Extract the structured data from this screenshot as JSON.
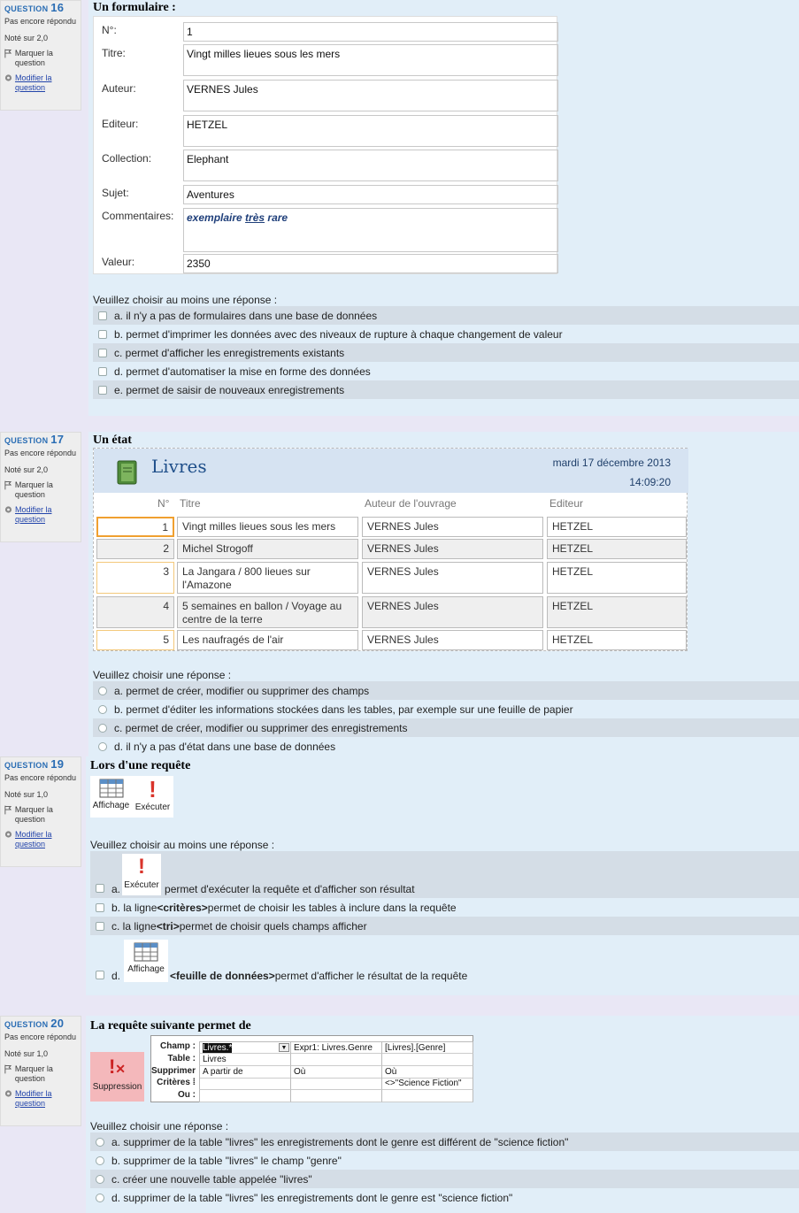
{
  "colors": {
    "accent": "#2a6db4",
    "content_bg": "#e1eef8",
    "alt_row": "#d4dde6",
    "report_header": "#d6e3f2",
    "danger_icon": "#d9342b",
    "suppression_bg": "#f4b8bb"
  },
  "sidebar_common": {
    "status": "Pas encore répondu",
    "flag": "Marquer la question",
    "edit": "Modifier la question",
    "question_word": "QUESTION"
  },
  "q16": {
    "number": "16",
    "grade": "Noté sur 2,0",
    "title": "Un formulaire  :",
    "form": [
      {
        "label": "N°:",
        "value": "1"
      },
      {
        "label": "Titre:",
        "value": "Vingt milles lieues sous les mers"
      },
      {
        "label": "Auteur:",
        "value": "VERNES Jules"
      },
      {
        "label": "Editeur:",
        "value": "HETZEL"
      },
      {
        "label": "Collection:",
        "value": "Elephant"
      },
      {
        "label": "Sujet:",
        "value": "Aventures"
      },
      {
        "label": "Commentaires:",
        "value_a": "exemplaire ",
        "value_b": "très",
        "value_c": " rare"
      },
      {
        "label": "Valeur:",
        "value": "2350"
      }
    ],
    "prompt": "Veuillez choisir au moins une réponse :",
    "options": [
      "a. il n'y a pas de formulaires dans une base de données",
      "b. permet d'imprimer les données avec des niveaux de rupture à chaque changement de valeur",
      "c. permet d'afficher les enregistrements existants",
      "d. permet d'automatiser la mise en forme des données",
      "e. permet de saisir de nouveaux enregistrements"
    ]
  },
  "q17": {
    "number": "17",
    "grade": "Noté sur 2,0",
    "title": "Un état",
    "report": {
      "title": "Livres",
      "date": "mardi 17 décembre 2013",
      "time": "14:09:20",
      "headers": [
        "N°",
        "Titre",
        "Auteur de l'ouvrage",
        "Editeur"
      ],
      "rows": [
        [
          "1",
          "Vingt milles lieues sous les mers",
          "VERNES Jules",
          "HETZEL"
        ],
        [
          "2",
          "Michel Strogoff",
          "VERNES Jules",
          "HETZEL"
        ],
        [
          "3",
          "La Jangara / 800 lieues sur l'Amazone",
          "VERNES Jules",
          "HETZEL"
        ],
        [
          "4",
          "5 semaines en ballon / Voyage au centre de la terre",
          "VERNES Jules",
          "HETZEL"
        ],
        [
          "5",
          "Les naufragés de l'air",
          "VERNES Jules",
          "HETZEL"
        ]
      ]
    },
    "prompt": "Veuillez choisir une réponse :",
    "options": [
      "a. permet de créer, modifier ou supprimer des champs",
      "b. permet d'éditer les informations stockées dans les tables, par exemple sur une feuille de papier",
      "c. permet de créer, modifier ou supprimer des enregistrements",
      "d. il n'y a pas d'état dans une base de données"
    ]
  },
  "q19": {
    "number": "19",
    "grade": "Noté sur 1,0",
    "title": "Lors d'une requête",
    "ribbon": {
      "view": "Affichage",
      "run": "Exécuter"
    },
    "prompt": "Veuillez choisir au moins une réponse :",
    "opt_a_letter": "a.",
    "opt_a_text": " permet d'exécuter la requête et d'afficher son résultat",
    "opt_b_pre": "b. la ligne ",
    "opt_b_bold": "<critères>",
    "opt_b_post": " permet de choisir les tables à inclure dans la requête",
    "opt_c_pre": "c. la ligne ",
    "opt_c_bold": "<tri>",
    "opt_c_post": " permet de choisir quels champs afficher",
    "opt_d_letter": "d.",
    "opt_d_bold": "<feuille de données>",
    "opt_d_post": "permet d'afficher le résultat de la requête"
  },
  "q20": {
    "number": "20",
    "grade": "Noté sur 1,0",
    "title": "La requête suivante permet de",
    "button": "Suppression",
    "grid": {
      "labels": [
        "Champ :",
        "Table :",
        "Supprimer :",
        "Critères :",
        "Ou :"
      ],
      "col1": [
        "Livres.*",
        "Livres",
        "A partir de",
        "",
        ""
      ],
      "col2": [
        "Expr1: Livres.Genre",
        "",
        "Où",
        "",
        ""
      ],
      "col3": [
        "[Livres].[Genre]",
        "",
        "Où",
        "<>\"Science Fiction\"",
        ""
      ]
    },
    "prompt": "Veuillez choisir une réponse :",
    "options": [
      "a. supprimer de la table \"livres\" les enregistrements dont le genre est différent de \"science fiction\"",
      "b. supprimer de la table \"livres\" le champ \"genre\"",
      "c. créer une nouvelle table appelée \"livres\"",
      "d. supprimer de la table \"livres\" les enregistrements dont le genre est \"science fiction\""
    ]
  }
}
